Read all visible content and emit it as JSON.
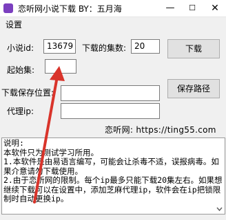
{
  "window": {
    "title": "恋听网小说下载 BY：五月海"
  },
  "menu": {
    "settings": "设置"
  },
  "form": {
    "novel_id_label": "小说id:",
    "novel_id_value": "13679",
    "count_label": "下载的集数:",
    "count_value": "20",
    "download_button": "下载",
    "start_label": "起始集:",
    "start_value": "",
    "savepath_label": "下载保存位置:",
    "savepath_value": "",
    "savepath_button": "保存路径",
    "proxy_label": "代理ip:",
    "proxy_value": ""
  },
  "footer": "恋听网: https://ting55.com",
  "info_lines": [
    "说明:",
    "本软件只为测试学习所用。",
    "1.本软件是由易语言编写，可能会让杀毒不适，误报病毒。如",
    "果介意请勿下载使用。",
    "2.由于恋听网的限制。每个ip最多只能下载20集左右。如果想",
    "继续下载可以在设置中，添加芝麻代理ip，软件会在ip把锁限",
    "制时自动更换ip。"
  ],
  "colors": {
    "arrow": "#d9342b",
    "accent": "#7b3fbf"
  }
}
